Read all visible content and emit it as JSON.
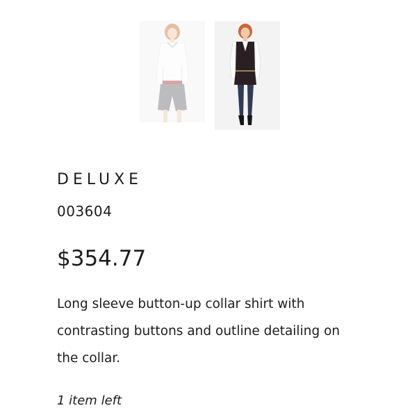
{
  "product": {
    "thumbnails": [
      {
        "icon": "product-photo-shorts-outfit",
        "selected": false
      },
      {
        "icon": "product-photo-vest-dress-outfit",
        "selected": true
      }
    ],
    "brand": "DELUXE",
    "sku": "003604",
    "price": "$354.77",
    "description": "Long sleeve button-up collar shirt with contrasting buttons and outline detailing on the collar.",
    "stock": "1 item left"
  }
}
